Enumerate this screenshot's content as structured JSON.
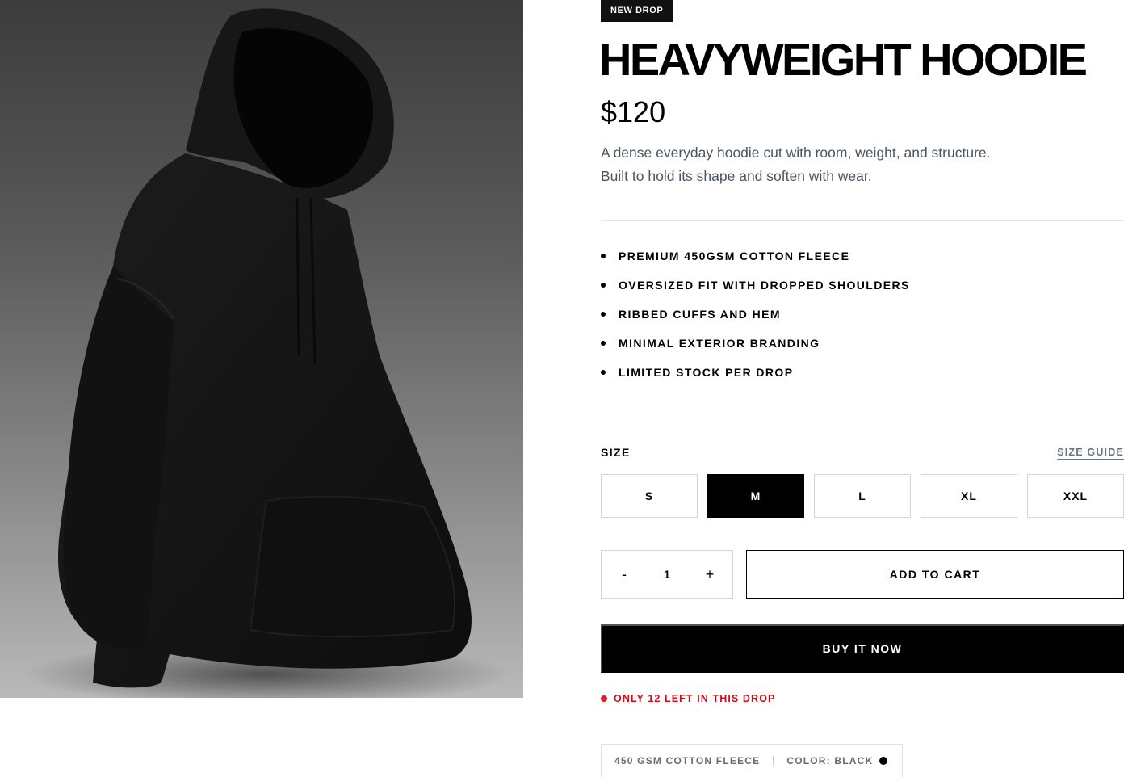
{
  "product": {
    "badge": "NEW DROP",
    "title": "HEAVYWEIGHT HOODIE",
    "price": "$120",
    "description_lines": [
      "A dense everyday hoodie cut with room, weight, and structure.",
      "Built to hold its shape and soften with wear."
    ],
    "image_alt": "black hoodie product photo",
    "features": [
      "PREMIUM 450GSM COTTON FLEECE",
      "OVERSIZED FIT WITH DROPPED SHOULDERS",
      "RIBBED CUFFS AND HEM",
      "MINIMAL EXTERIOR BRANDING",
      "LIMITED STOCK PER DROP"
    ]
  },
  "size": {
    "label": "SIZE",
    "guide_label": "SIZE GUIDE",
    "options": [
      "S",
      "M",
      "L",
      "XL",
      "XXL"
    ],
    "selected": "M"
  },
  "purchase": {
    "qty_minus": "-",
    "qty_value": "1",
    "qty_plus": "+",
    "add_to_cart": "ADD TO CART",
    "buy_now": "BUY IT NOW"
  },
  "stock": {
    "text": "ONLY 12 LEFT IN THIS DROP",
    "color": "#dc1f26"
  },
  "meta": {
    "material": "450 GSM COTTON FLEECE",
    "color_label": "COLOR: BLACK",
    "swatch_color": "#000000"
  }
}
